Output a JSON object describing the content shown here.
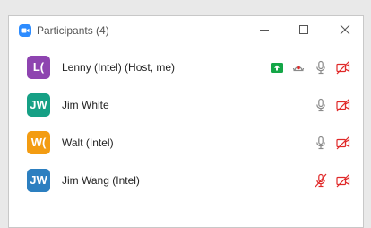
{
  "window": {
    "title": "Participants (4)"
  },
  "colors": {
    "app_icon": "#2d8cff",
    "share_green": "#14a647",
    "muted_red": "#e02828",
    "icon_gray": "#8a8a8a"
  },
  "participants": [
    {
      "initials": "L(",
      "name": "Lenny (Intel) (Host, me)",
      "avatar_color": "#8e44b0",
      "icons": [
        "screen-share-icon",
        "record-icon",
        "microphone-icon",
        "video-off-icon"
      ]
    },
    {
      "initials": "JW",
      "name": "Jim White",
      "avatar_color": "#16a085",
      "icons": [
        "microphone-icon",
        "video-off-icon"
      ]
    },
    {
      "initials": "W(",
      "name": "Walt (Intel)",
      "avatar_color": "#f39c12",
      "icons": [
        "microphone-icon",
        "video-off-icon"
      ]
    },
    {
      "initials": "JW",
      "name": "Jim Wang (Intel)",
      "avatar_color": "#2c7fc0",
      "icons": [
        "microphone-muted-icon",
        "video-off-icon"
      ]
    }
  ]
}
